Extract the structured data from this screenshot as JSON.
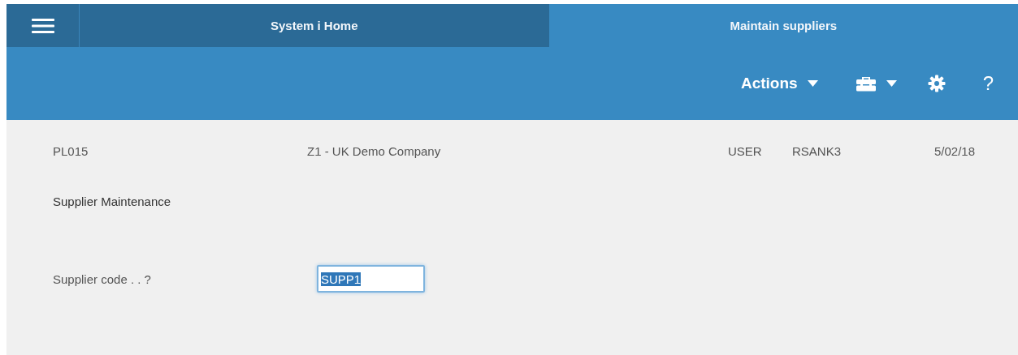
{
  "tabs": [
    {
      "label": "System i Home",
      "selected": false
    },
    {
      "label": "Maintain suppliers",
      "selected": true
    }
  ],
  "toolbar": {
    "actions_label": "Actions",
    "help": "?"
  },
  "header": {
    "program": "PL015",
    "company": "Z1 - UK Demo Company",
    "user_label": "USER",
    "user": "RSANK3",
    "date": "5/02/18"
  },
  "title": "Supplier Maintenance",
  "field": {
    "label": "Supplier code . . ?",
    "value": "SUPP1",
    "value_selected": true
  }
}
